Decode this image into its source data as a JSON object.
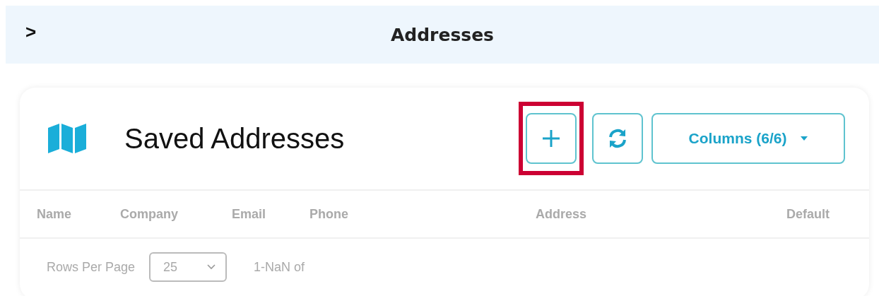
{
  "header": {
    "toggle": ">",
    "title": "Addresses"
  },
  "card": {
    "title": "Saved Addresses",
    "buttons": [
      {
        "kind": "add",
        "highlighted": true
      },
      {
        "kind": "refresh",
        "highlighted": false
      },
      {
        "kind": "columns",
        "label": "Columns (6/6)",
        "highlighted": false
      }
    ]
  },
  "table": {
    "columns": [
      "Name",
      "Company",
      "Email",
      "Phone",
      "Address",
      "Default"
    ]
  },
  "footer": {
    "rows_label": "Rows Per Page",
    "rows_value": "25",
    "range": "1-NaN of"
  }
}
